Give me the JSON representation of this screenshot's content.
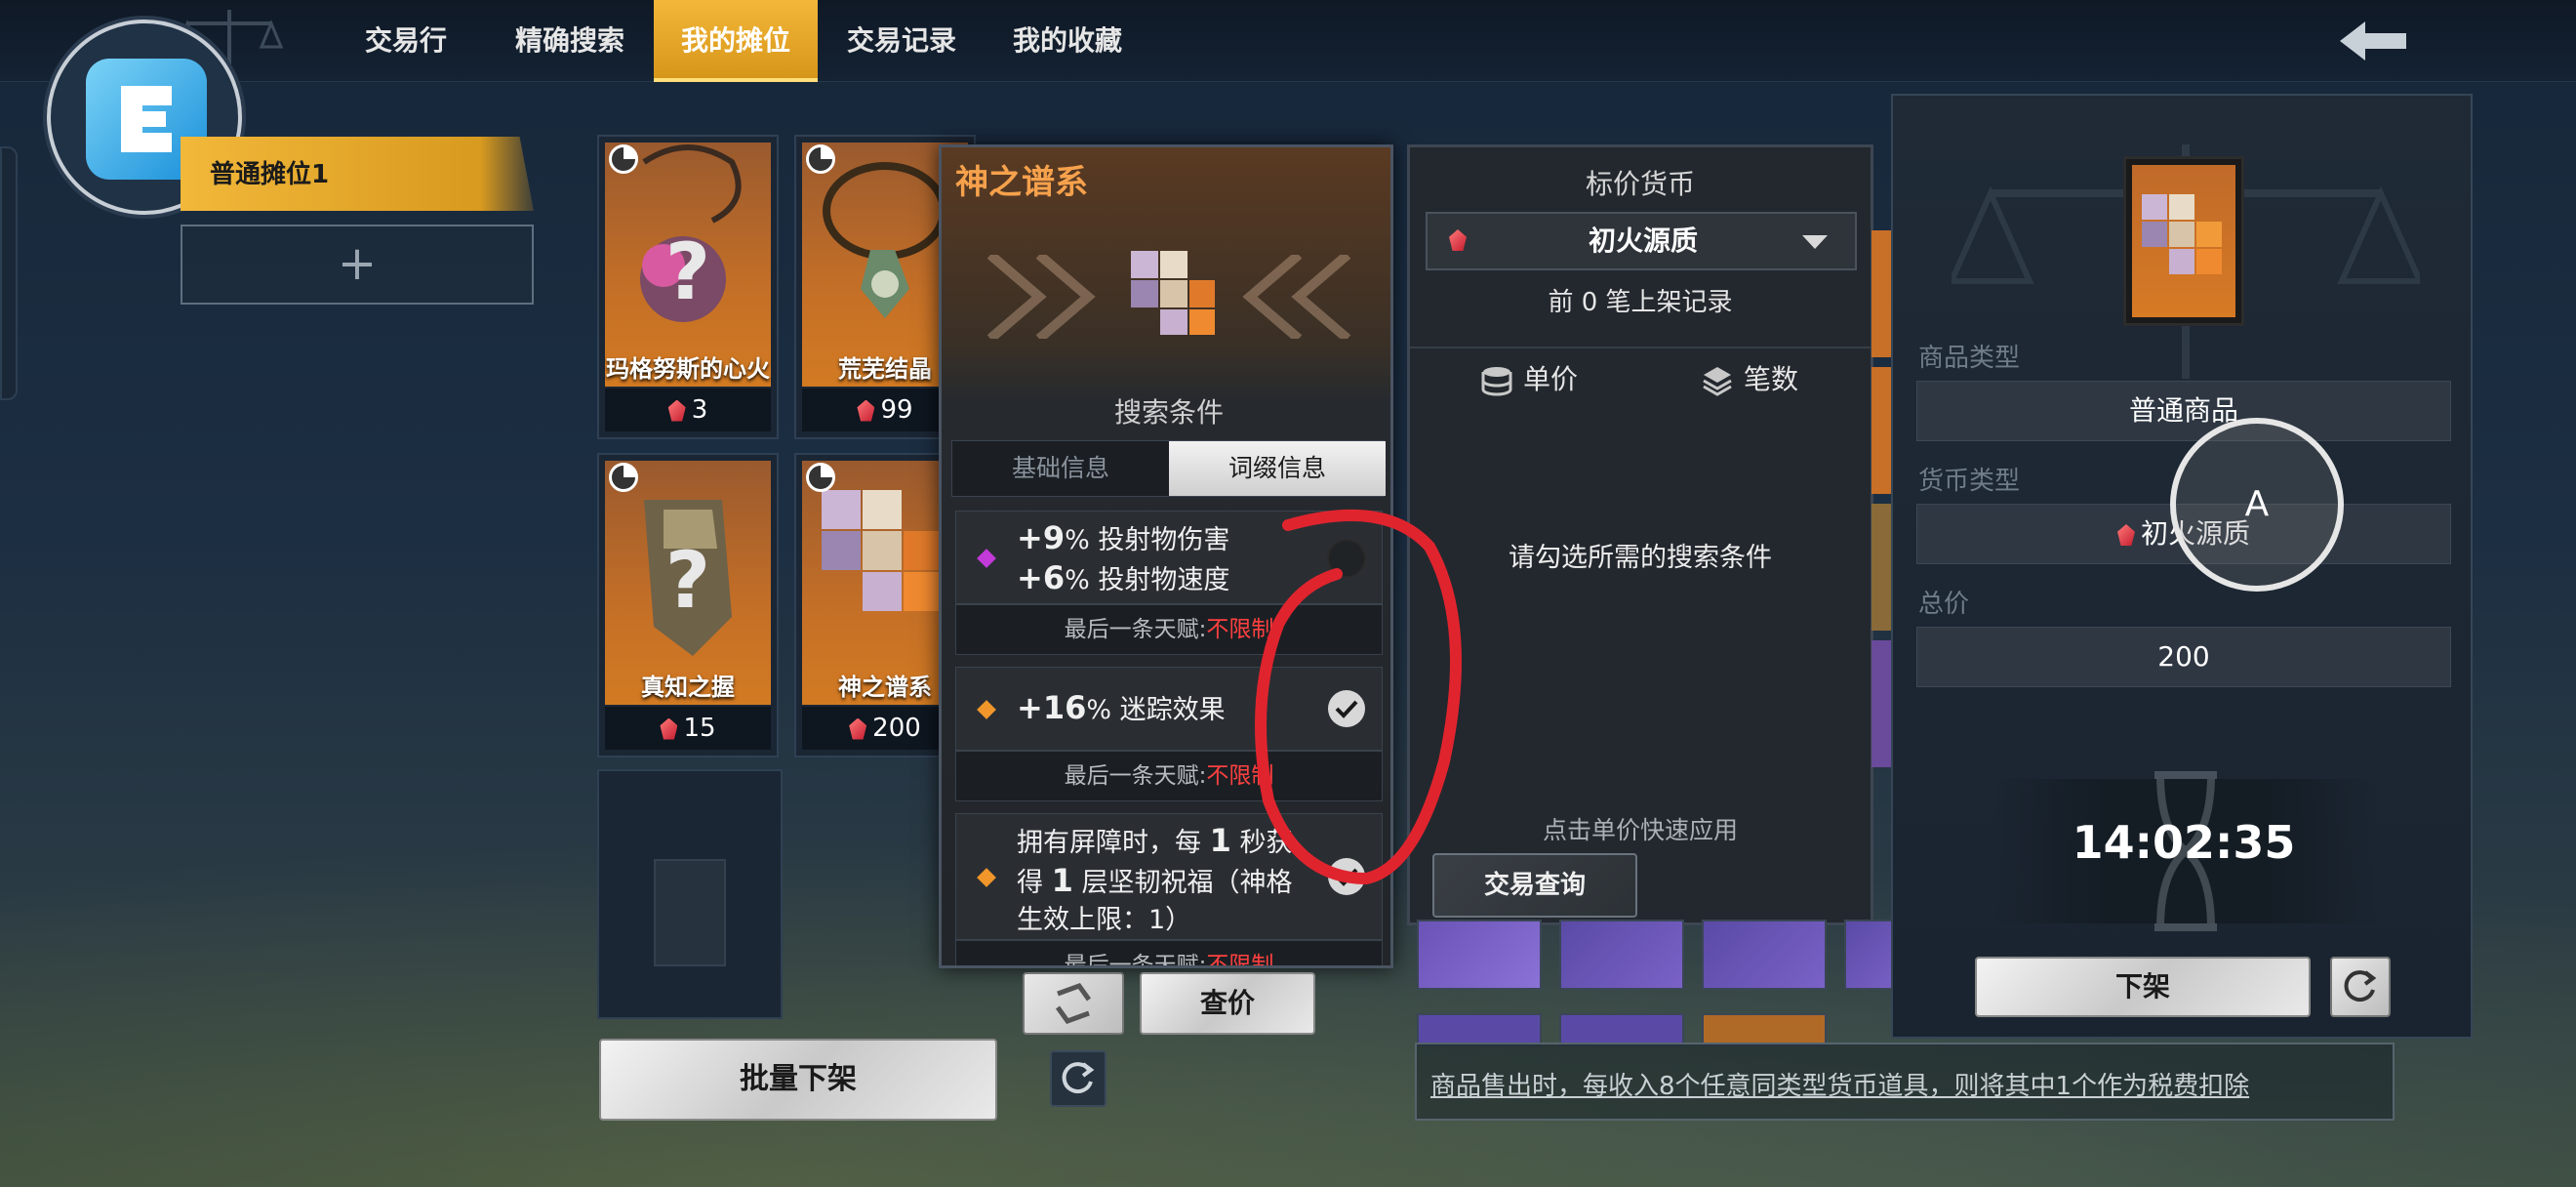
{
  "nav": {
    "tabs": [
      {
        "label": "交易行",
        "active": false
      },
      {
        "label": "精确搜索",
        "active": false
      },
      {
        "label": "我的摊位",
        "active": true
      },
      {
        "label": "交易记录",
        "active": false
      },
      {
        "label": "我的收藏",
        "active": false
      }
    ]
  },
  "sidebar": {
    "booth_label": "普通摊位1",
    "add_label": "+"
  },
  "items": [
    {
      "name": "玛格努斯的心火",
      "price": "3"
    },
    {
      "name": "荒芜结晶",
      "price": "99"
    },
    {
      "name": "真知之握",
      "price": "15"
    },
    {
      "name": "神之谱系",
      "price": "200"
    }
  ],
  "buttons": {
    "batch_delist": "批量下架",
    "check_price": "查价",
    "trade_query": "交易查询",
    "delist": "下架"
  },
  "popup": {
    "title": "神之谱系",
    "subtitle": "搜索条件",
    "tabs": [
      "基础信息",
      "词缀信息"
    ],
    "affixes": [
      {
        "line1_value": "+9",
        "line1_text": "% 投射物伤害",
        "line2_value": "+6",
        "line2_text": "% 投射物速度",
        "checked": false,
        "color": "#c23ad8"
      },
      {
        "line1_value": "+16",
        "line1_text": "% 迷踪效果",
        "checked": true,
        "color": "#f0962a"
      },
      {
        "line1_pre": "拥有屏障时，每",
        "line1_value": "1",
        "line1_text": "秒获",
        "line2_pre": "得",
        "line2_value": "1",
        "line2_text": "层坚韧祝福（神格",
        "line3": "生效上限：1）",
        "checked": true,
        "color": "#f0962a"
      }
    ],
    "affix_footer_label": "最后一条天赋:",
    "affix_footer_value": "不限制"
  },
  "price_panel": {
    "title": "标价货币",
    "currency": "初火源质",
    "records": "前 0 笔上架记录",
    "col_unit": "单价",
    "col_count": "笔数",
    "message": "请勾选所需的搜索条件",
    "hint": "点击单价快速应用"
  },
  "right_panel": {
    "goods_type_label": "商品类型",
    "goods_type_value": "普通商品",
    "currency_type_label": "货币类型",
    "currency_type_value": "初火源质",
    "total_label": "总价",
    "total_value": "200",
    "timer": "14:02:35"
  },
  "overlay": {
    "label": "A"
  },
  "tax_notice": "商品售出时，每收入8个任意同类型货币道具，则将其中1个作为税费扣除",
  "colors": {
    "accent_gold": "#f2b83a",
    "popup_title": "#f6a14c",
    "warn_red": "#ff4040",
    "annotation_red": "#e0242e"
  }
}
